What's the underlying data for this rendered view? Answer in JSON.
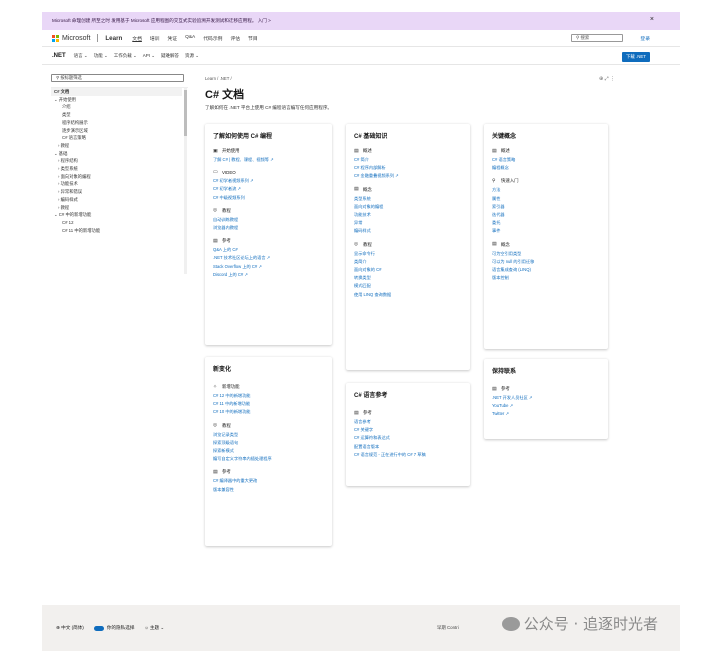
{
  "banner": {
    "text": "Microsoft 命理创建 所至之时 发用基于 Microsoft 应用程图的交互式实验追溯开发测试和迁移应用程。 入门 >",
    "close": "×"
  },
  "header": {
    "brand": "Microsoft",
    "learn": "Learn",
    "nav": [
      "文档",
      "培训",
      "凭证",
      "Q&A",
      "代码示例",
      "评估",
      "节目"
    ],
    "search_placeholder": "搜索",
    "sign_in": "登录"
  },
  "subnav": {
    "product": ".NET",
    "items": [
      "语言 ⌄",
      "功能 ⌄",
      "工作负载 ⌄",
      "API ⌄",
      "疑难解答",
      "资源 ⌄"
    ],
    "download": "下载 .NET"
  },
  "sidebar": {
    "filter_placeholder": "按标题筛选",
    "items": [
      "C# 文档",
      "⌄ 开始使用",
      "介绍",
      "类型",
      "程序结构展示",
      "逐步演示区域",
      "C# 语言策略",
      "› 教程",
      "⌄ 基础",
      "› 程序结构",
      "› 类型系统",
      "› 面向对象的编程",
      "› 功能技术",
      "› 异常和错误",
      "› 编码样式",
      "› 教程",
      "⌄ C# 中的新增功能",
      "C# 12",
      "C# 11 中的新增功能"
    ]
  },
  "page": {
    "breadcrumb": "Learn / .NET /",
    "title": "C# 文档",
    "description": "了解如何在 .NET 平台上使用 C# 编程语言编写任何应用程序。",
    "actions": "⊕  ⤢  ⋮"
  },
  "cards": [
    {
      "title": "了解如何使用 C# 编程",
      "groups": [
        {
          "icon": "▣",
          "name": "开始使用",
          "links": [
            "了解 C# | 教程、课程、视频等 ↗"
          ]
        },
        {
          "icon": "▭",
          "name": "VIDEO",
          "links": [
            "C# 初学者视频系列 ↗",
            "C# 初学者流 ↗",
            "C# 中级视频系列"
          ]
        },
        {
          "icon": "◎",
          "name": "教程",
          "links": [
            "自动训练教程",
            "浏览器内教程"
          ]
        },
        {
          "icon": "▤",
          "name": "参考",
          "links": [
            "Q&A 上的 C#",
            ".NET 技术社区论坛上的语言 ↗",
            "Stack Overflow 上的 C# ↗",
            "Discord 上的 C# ↗"
          ]
        }
      ]
    },
    {
      "title": "C# 基础知识",
      "groups": [
        {
          "icon": "▤",
          "name": "概述",
          "links": [
            "C# 简介",
            "C# 程序内部解析",
            "C# 金融重叠视频系列 ↗"
          ]
        },
        {
          "icon": "▤",
          "name": "概念",
          "links": [
            "类型系统",
            "面向对象的编程",
            "功能技术",
            "异常",
            "编码样式"
          ]
        },
        {
          "icon": "◎",
          "name": "教程",
          "links": [
            "显示命令行",
            "类简介",
            "面向对象的 C#",
            "转换类型",
            "模式匹配",
            "使用 LINQ 查询数据"
          ]
        }
      ]
    },
    {
      "title": "关键概念",
      "groups": [
        {
          "icon": "▤",
          "name": "概述",
          "links": [
            "C# 语言策略",
            "编程概念"
          ]
        },
        {
          "icon": "⚲",
          "name": "快速入门",
          "links": [
            "方法",
            "属性",
            "索引器",
            "迭代器",
            "委托",
            "事件"
          ]
        },
        {
          "icon": "▤",
          "name": "概念",
          "links": [
            "可为空引用类型",
            "可以为 null 的引用迁移",
            "语言集成查询 (LINQ)",
            "版本控制"
          ]
        }
      ]
    },
    {
      "title": "新变化",
      "groups": [
        {
          "icon": "✧",
          "name": "新增功能",
          "links": [
            "C# 12 中的新增功能",
            "C# 11 中的新增功能",
            "C# 10 中的新增功能"
          ]
        },
        {
          "icon": "◎",
          "name": "教程",
          "links": [
            "浏览记录类型",
            "探索顶级语句",
            "探索新模式",
            "编写自定义字符串内插处理程序"
          ]
        },
        {
          "icon": "▤",
          "name": "参考",
          "links": [
            "C# 编译器中的重大更改",
            "版本兼容性"
          ]
        }
      ]
    },
    {
      "title": "C# 语言参考",
      "groups": [
        {
          "icon": "▤",
          "name": "参考",
          "links": [
            "语言参考",
            "C# 关键字",
            "C# 运算符和表达式",
            "配置语言版本",
            "C# 语言规范 - 正在进行中的 C# 7 草稿"
          ]
        }
      ]
    },
    {
      "title": "保持联系",
      "groups": [
        {
          "icon": "▤",
          "name": "参考",
          "links": [
            ".NET 开发人员社区 ↗",
            "YouTube ↗",
            "Twitter ↗"
          ]
        }
      ]
    }
  ],
  "footer": {
    "language": "⊕ 中文 (简体)",
    "privacy": "你的隐私选择",
    "theme": "☼ 主题 ⌄",
    "previous": "早期 Contri",
    "watermark": "公众号 · 追逐时光者"
  }
}
